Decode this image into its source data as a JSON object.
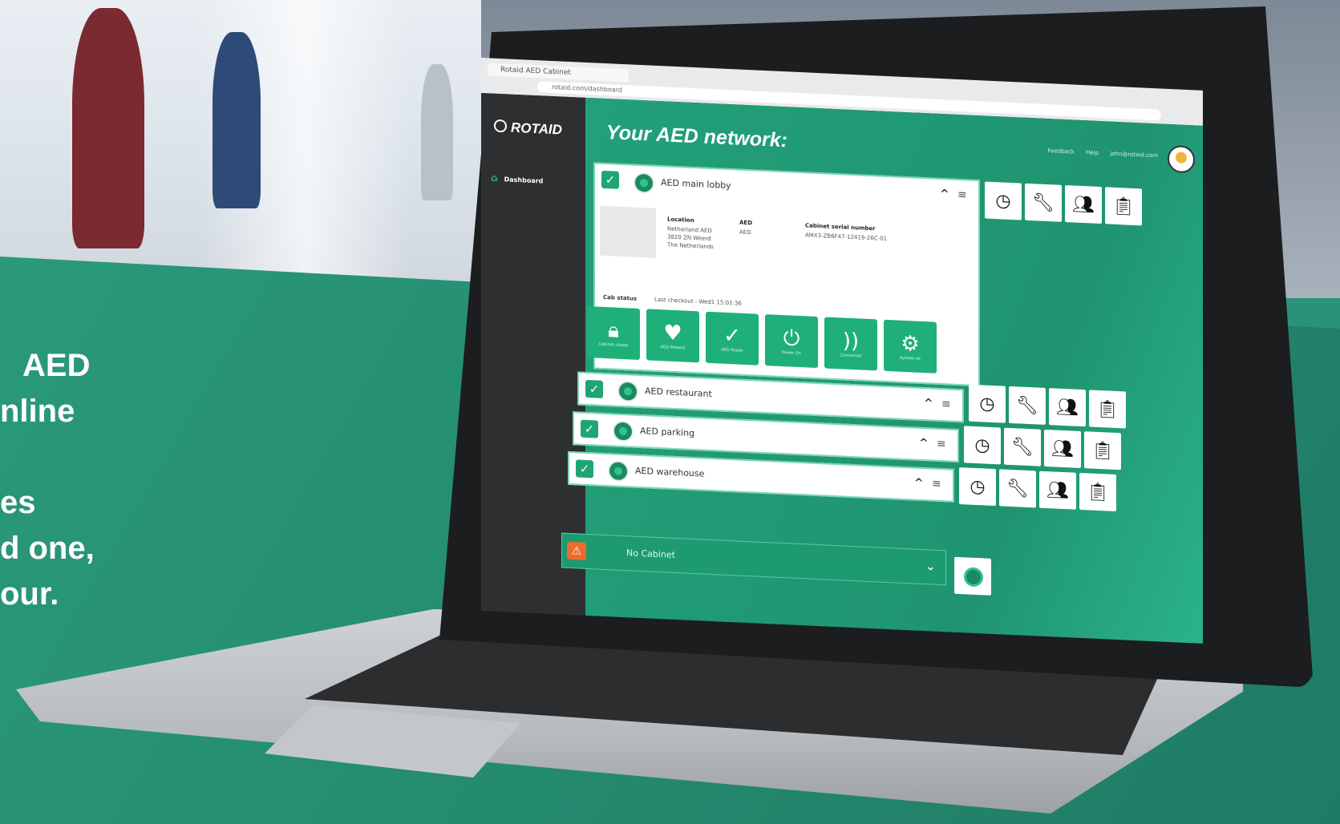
{
  "promo": {
    "lines": [
      "AED",
      "nline",
      "",
      "es",
      "d one,",
      "our."
    ]
  },
  "browser": {
    "tab_title": "Rotaid AED Cabinet",
    "url": "rotaid.com/dashboard"
  },
  "sidebar": {
    "brand": "ROTAID",
    "items": [
      {
        "label": "Dashboard",
        "icon": "house-icon"
      }
    ]
  },
  "header": {
    "title": "Your AED network:",
    "links": [
      "Feedback",
      "Help",
      "john@rotaid.com"
    ]
  },
  "aed_rows": [
    {
      "name": "AED main lobby",
      "expanded": true,
      "details": {
        "location_label": "Location",
        "location_lines": [
          "Netherland AED",
          "3820 ZN Weerd",
          "The Netherlands"
        ],
        "aed_label": "AED",
        "aed_value": "AED",
        "serial_label": "Cabinet serial number",
        "serial_value": "AMX3-ZB6F47-12419-26C-01"
      },
      "status_title": "Cab status",
      "last_checked": "Last checkout - Wed1 15:01:36",
      "status_tiles": [
        {
          "icon": "lock-icon",
          "label": "Cabinet closed"
        },
        {
          "icon": "heart-icon",
          "label": "AED Present"
        },
        {
          "icon": "check-icon",
          "label": "AED Ready"
        },
        {
          "icon": "power-icon",
          "label": "Power On"
        },
        {
          "icon": "signal-icon",
          "label": "Connected"
        },
        {
          "icon": "gear-icon",
          "label": "System ok"
        }
      ]
    },
    {
      "name": "AED restaurant",
      "expanded": false
    },
    {
      "name": "AED parking",
      "expanded": false
    },
    {
      "name": "AED warehouse",
      "expanded": false
    }
  ],
  "warning_row": {
    "text": "No Cabinet",
    "icon": "warning-icon"
  },
  "action_icons": [
    "clock-icon",
    "wrench-icon",
    "users-icon",
    "clipboard-icon"
  ],
  "colors": {
    "accent": "#1fa571",
    "panel": "#2a9a79",
    "warning": "#ef6a2e"
  }
}
